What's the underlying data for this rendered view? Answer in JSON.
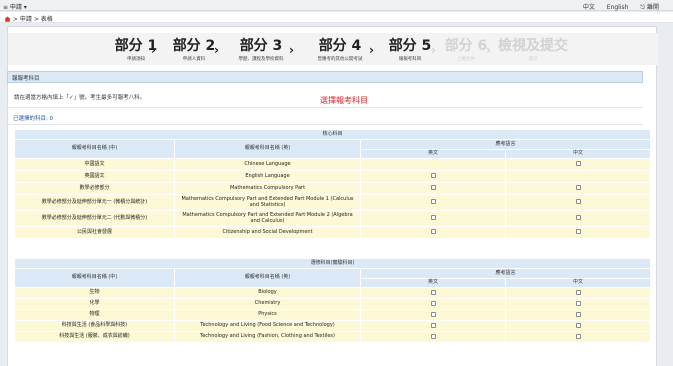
{
  "topbar": {
    "menu": "≡ 申請 ▾",
    "lang_zh": "中文",
    "lang_en": "English",
    "logout": "⎋ 離開"
  },
  "breadcrumb": {
    "sep": ">",
    "item1": "申請",
    "item2": "表格"
  },
  "steps": [
    {
      "title": "部分 1",
      "sub": "申請須知"
    },
    {
      "title": "部分 2",
      "sub": "申請人資料"
    },
    {
      "title": "部分 3",
      "sub": "學歷、課程及學校資料"
    },
    {
      "title": "部分 4",
      "sub": "曾應考的其他公開考試"
    },
    {
      "title": "部分 5",
      "sub": "報報考科目"
    },
    {
      "title": "部分 6",
      "sub": "上載文件"
    },
    {
      "title": "檢視及提交",
      "sub": "遞交"
    }
  ],
  "section_title": "報報考科目",
  "instruction": "請在適當方格內填上「✓」號。考生最多可報考八科。",
  "red_label": "選擇報考科目",
  "selected_count": "已選擇的科目: 0",
  "core": {
    "title": "核心科目",
    "col_zh": "報報考科目名稱 (中)",
    "col_en": "報報考科目名稱 (英)",
    "col_lang": "應考語言",
    "lang_en": "英文",
    "lang_zh": "中文",
    "rows": [
      {
        "zh": "中國語文",
        "en": "Chinese Language",
        "en_box": false,
        "zh_box": true
      },
      {
        "zh": "英國語文",
        "en": "English Language",
        "en_box": true,
        "zh_box": false
      },
      {
        "zh": "數學必修部分",
        "en": "Mathematics Compulsory Part",
        "en_box": true,
        "zh_box": true
      },
      {
        "zh": "數學必修部分及延伸部分單元一 (微積分與統計)",
        "en": "Mathematics Compulsory Part and Extended Part Module 1 (Calculus and Statistics)",
        "en_box": true,
        "zh_box": true
      },
      {
        "zh": "數學必修部分及延伸部分單元二 (代數與微積分)",
        "en": "Mathematics Compulsory Part and Extended Part Module 2 (Algebra and Calculus)",
        "en_box": true,
        "zh_box": true
      },
      {
        "zh": "公民與社會發展",
        "en": "Citizenship and Social Development",
        "en_box": true,
        "zh_box": true
      }
    ]
  },
  "elective": {
    "title": "選修科目(實驗科目)",
    "col_zh": "報報考科目名稱 (中)",
    "col_en": "報報考科目名稱 (英)",
    "col_lang": "應考語言",
    "lang_en": "英文",
    "lang_zh": "中文",
    "rows": [
      {
        "zh": "生物",
        "en": "Biology",
        "en_box": true,
        "zh_box": true
      },
      {
        "zh": "化學",
        "en": "Chemistry",
        "en_box": true,
        "zh_box": true
      },
      {
        "zh": "物理",
        "en": "Physics",
        "en_box": true,
        "zh_box": true
      },
      {
        "zh": "科技與生活 (食品科學與科技)",
        "en": "Technology and Living (Food Science and Technology)",
        "en_box": true,
        "zh_box": true
      },
      {
        "zh": "科技與生活 (服裝、成衣與紡織)",
        "en": "Technology and Living (Fashion, Clothing and Textiles)",
        "en_box": true,
        "zh_box": true
      }
    ]
  }
}
